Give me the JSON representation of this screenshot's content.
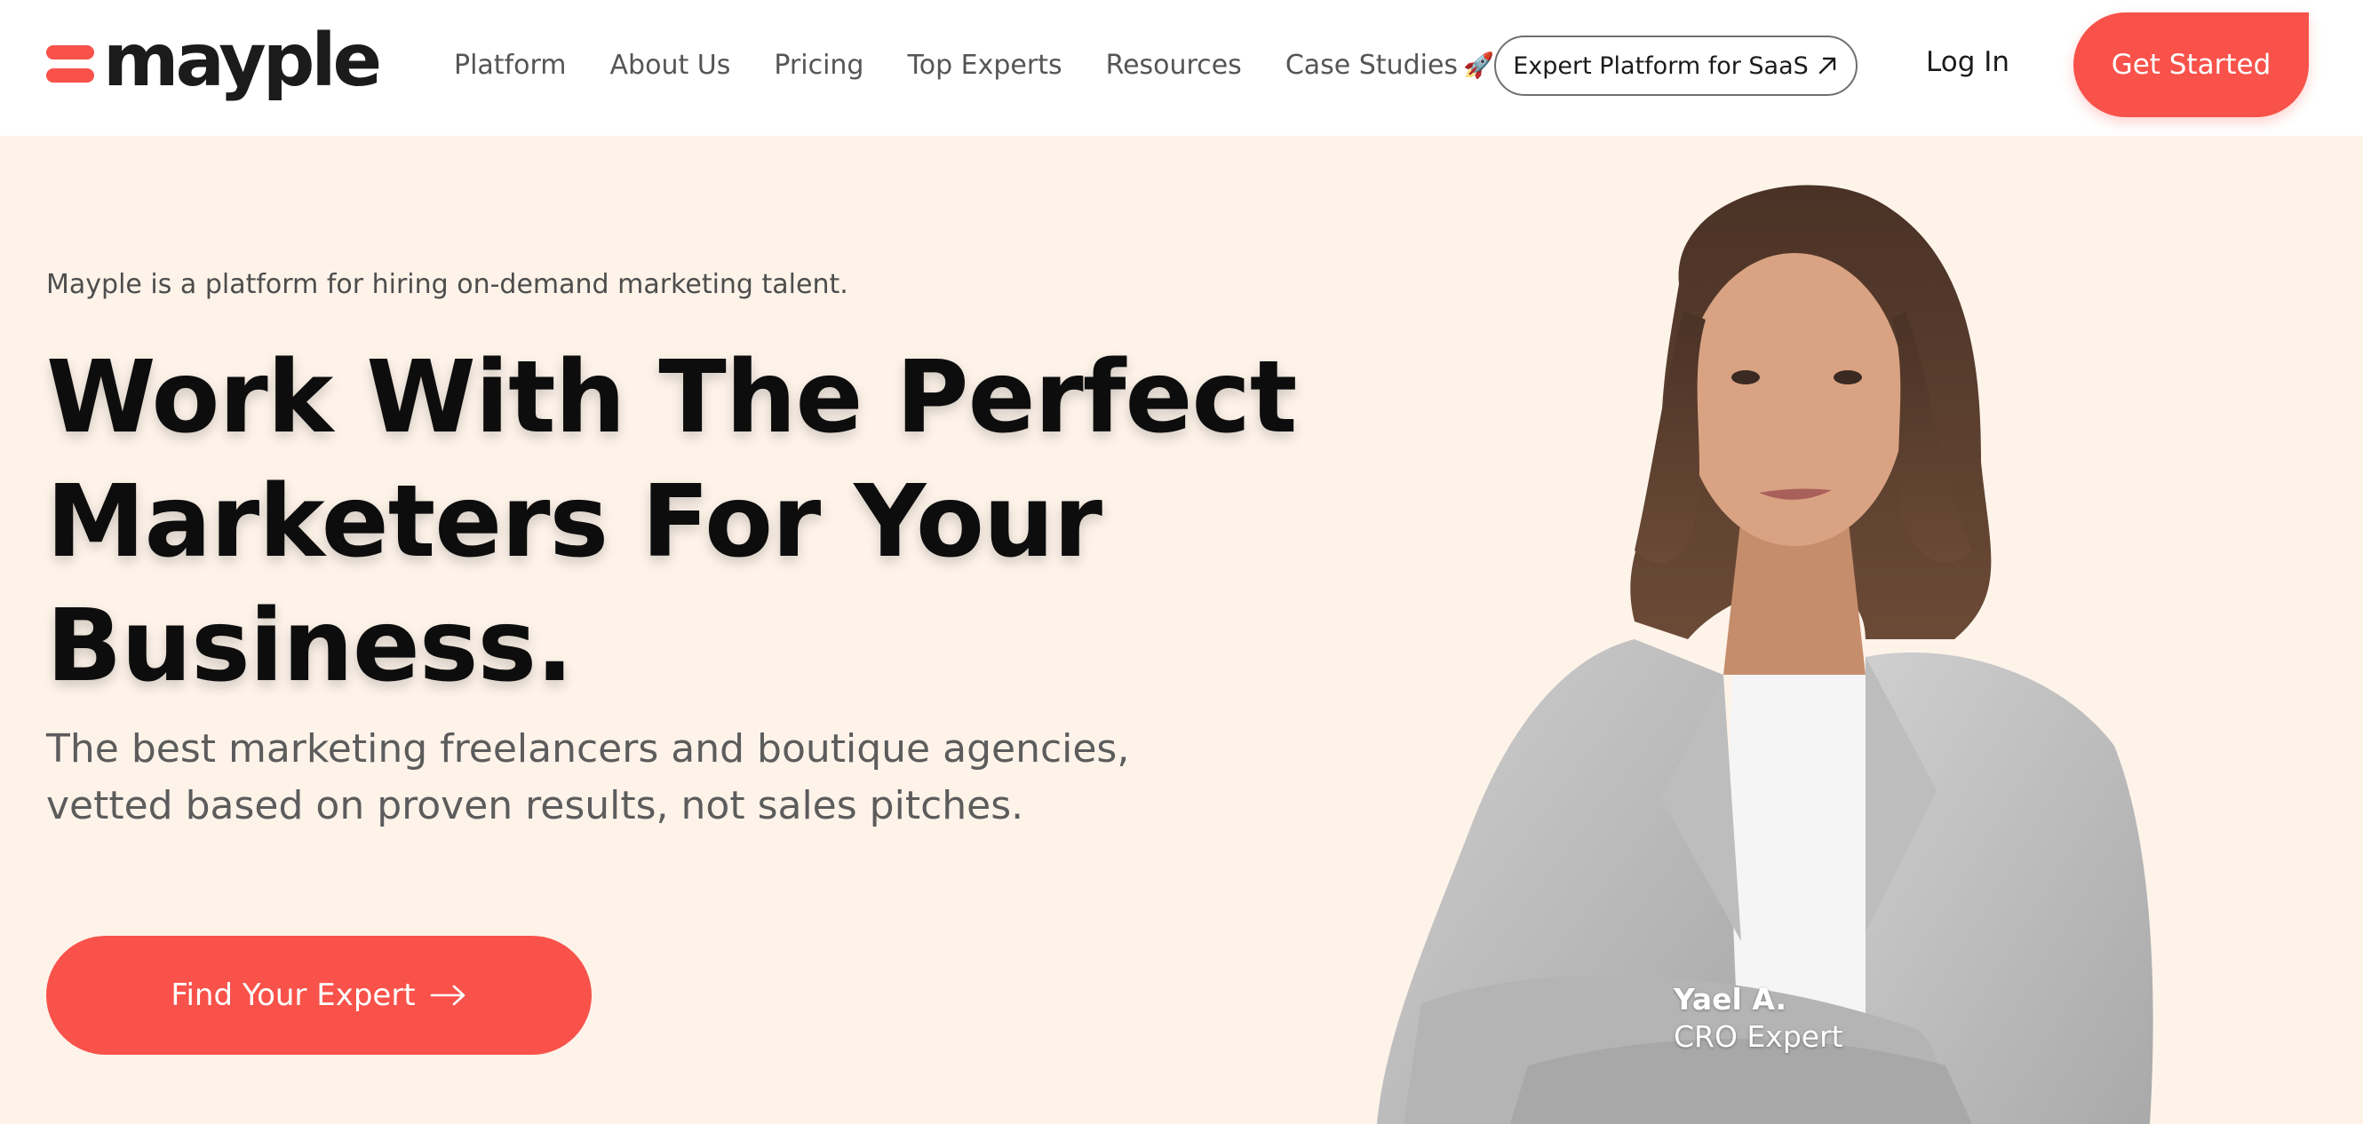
{
  "header": {
    "logo_text": "mayple",
    "nav": [
      {
        "label": "Platform"
      },
      {
        "label": "About Us"
      },
      {
        "label": "Pricing"
      },
      {
        "label": "Top Experts"
      },
      {
        "label": "Resources"
      },
      {
        "label": "Case Studies",
        "emoji": "🚀"
      }
    ],
    "saas_button": "Expert Platform for SaaS",
    "login": "Log In",
    "get_started": "Get Started"
  },
  "hero": {
    "tagline": "Mayple is a platform for hiring on-demand marketing talent.",
    "headline": [
      "Work With The Perfect",
      "Marketers For Your",
      "Business."
    ],
    "subhead": [
      "The best marketing freelancers and boutique agencies,",
      "vetted based on proven results, not sales pitches."
    ],
    "cta": "Find Your Expert"
  },
  "expert": {
    "name": "Yael A.",
    "role": "CRO Expert"
  },
  "colors": {
    "accent": "#f8524a",
    "hero_bg": "#fdf3e9",
    "text": "#0d0d0d"
  }
}
